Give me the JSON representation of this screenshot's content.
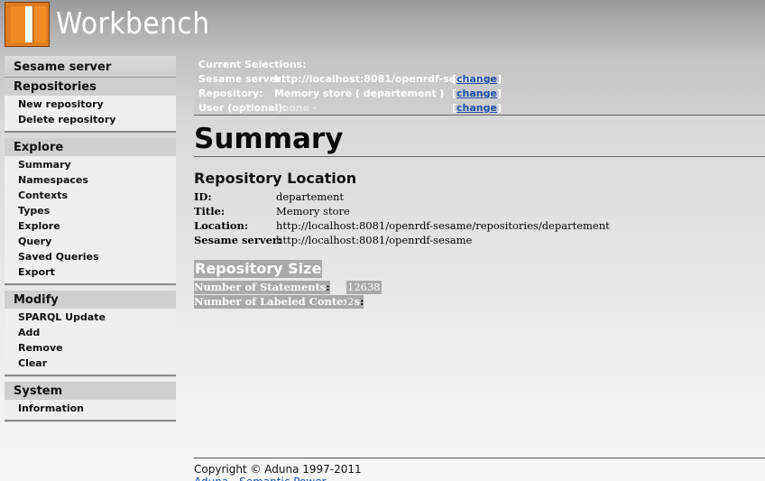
{
  "header": {
    "brand": "Workbench"
  },
  "sidebar": {
    "top": "Sesame server",
    "sections": [
      {
        "title": "Repositories",
        "items": [
          "New repository",
          "Delete repository"
        ]
      },
      {
        "title": "Explore",
        "items": [
          "Summary",
          "Namespaces",
          "Contexts",
          "Types",
          "Explore",
          "Query",
          "Saved Queries",
          "Export"
        ]
      },
      {
        "title": "Modify",
        "items": [
          "SPARQL Update",
          "Add",
          "Remove",
          "Clear"
        ]
      },
      {
        "title": "System",
        "items": [
          "Information"
        ]
      }
    ]
  },
  "selections": {
    "title": "Current Selections:",
    "rows": [
      {
        "label": "Sesame server:",
        "value": "http://localhost:8081/openrdf-sesame",
        "change": "change"
      },
      {
        "label": "Repository:",
        "value": "Memory store ( departement )",
        "change": "change"
      },
      {
        "label": "User (optional):",
        "value": "- none -",
        "change": "change"
      }
    ]
  },
  "main": {
    "title": "Summary",
    "location": {
      "title": "Repository Location",
      "rows": [
        {
          "label": "ID:",
          "value": "departement"
        },
        {
          "label": "Title:",
          "value": "Memory store"
        },
        {
          "label": "Location:",
          "value": "http://localhost:8081/openrdf-sesame/repositories/departement"
        },
        {
          "label": "Sesame server:",
          "value": "http://localhost:8081/openrdf-sesame"
        }
      ]
    },
    "size": {
      "title": "Repository Size",
      "rows": [
        {
          "label": "Number of Statements",
          "value": "12638"
        },
        {
          "label": "Number of Labeled Contexts",
          "value": "2"
        }
      ]
    }
  },
  "footer": {
    "copyright": "Copyright © Aduna 1997-2011",
    "link": "Aduna - Semantic Power"
  }
}
